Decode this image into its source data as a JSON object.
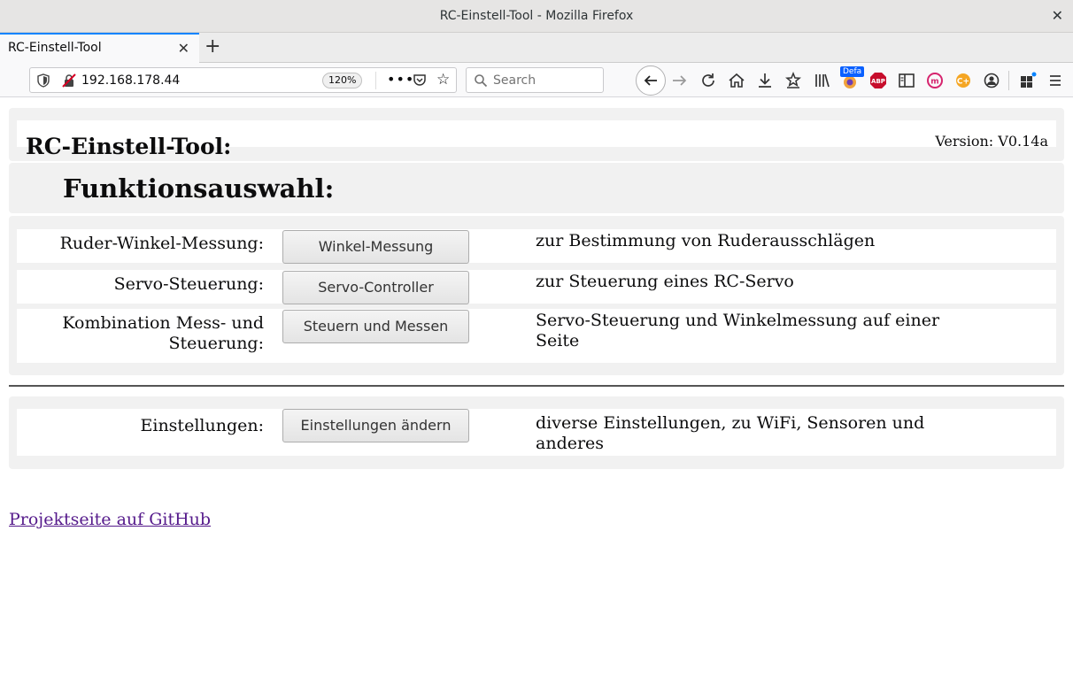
{
  "window": {
    "title": "RC-Einstell-Tool - Mozilla Firefox",
    "close": "✕"
  },
  "tab": {
    "title": "RC-Einstell-Tool",
    "close": "✕",
    "new_tab": "+"
  },
  "navbar": {
    "url": "192.168.178.44",
    "zoom": "120%",
    "more": "•••",
    "search_placeholder": "Search",
    "extension_badge": "Defa"
  },
  "page": {
    "title": "RC-Einstell-Tool:",
    "version": "Version: V0.14a",
    "section_heading": "Funktionsauswahl:",
    "functions": [
      {
        "label": "Ruder-Winkel-Messung:",
        "button": "Winkel-Messung",
        "description": "zur Bestimmung von Ruderausschlägen"
      },
      {
        "label": "Servo-Steuerung:",
        "button": "Servo-Controller",
        "description": "zur Steuerung eines RC-Servo"
      },
      {
        "label": "Kombination Mess- und Steuerung:",
        "button": "Steuern und Messen",
        "description": "Servo-Steuerung und Winkelmessung auf einer Seite"
      }
    ],
    "settings": {
      "label": "Einstellungen:",
      "button": "Einstellungen ändern",
      "description": "diverse Einstellungen, zu WiFi, Sensoren und anderes"
    },
    "github_link": "Projektseite auf GitHub"
  }
}
